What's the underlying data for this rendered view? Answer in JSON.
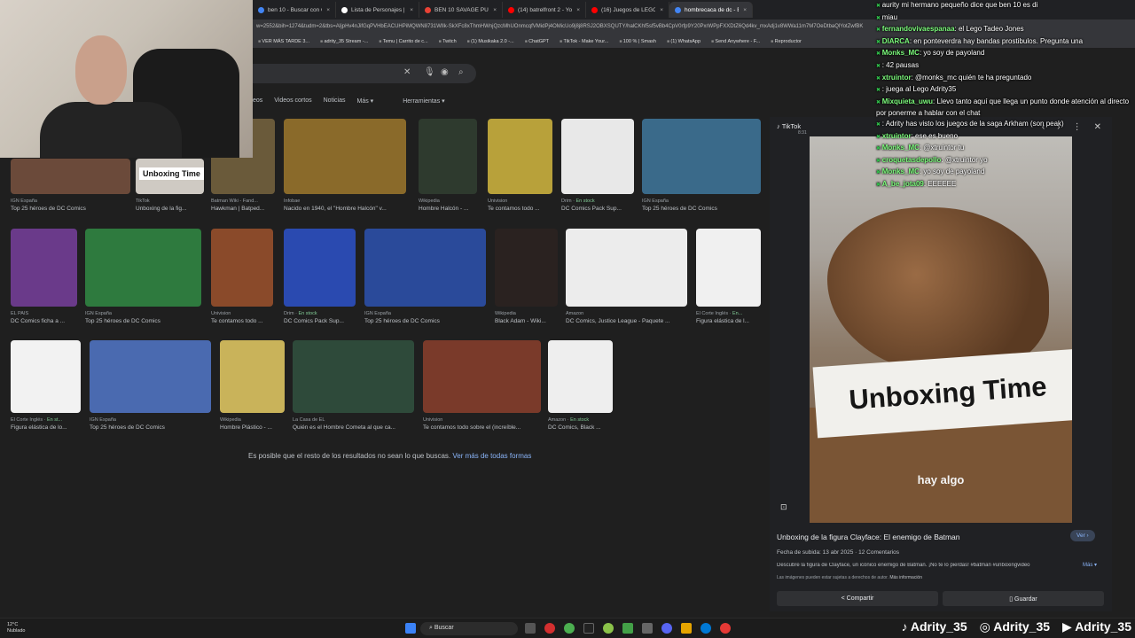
{
  "tabs": [
    {
      "label": "ben 10 - Buscar con Google",
      "color": "#4285f4",
      "active": false
    },
    {
      "label": "Lista de Personajes | Ben 10 Wiki",
      "color": "#ffffff",
      "active": false
    },
    {
      "label": "BEN 10 SAVAGE PURSUIT juego g",
      "color": "#e94235",
      "active": false
    },
    {
      "label": "(14) batrelfront 2 - YouTube",
      "color": "#ff0000",
      "active": false
    },
    {
      "label": "(16) Juegos de LEGO - Del Peor al",
      "color": "#ff0000",
      "active": false
    },
    {
      "label": "hombrecaca de dc - Buscar con G",
      "color": "#4285f4",
      "active": true
    }
  ],
  "address_text": "w=2552&bih=1274&tudm=2&tbs=AIjpHv4nJifGqPVHbEACUHPiMQWN8731WIlk-SkXFc8xThmHWnjQzcMhUOnmcqfVMidPj4OMicUo9j8j8RSJ2OBXSQUTY/halCKhf5sf5vBb4CpV0rfp9Y20PxrWPpFXXDtZ6Qd4kv_mxAdj1v8WWa11m7M7OeDtbaQlYotZwfBK",
  "bookmarks": [
    "VER MÁS TARDE 3...",
    "adrity_35 Stream -...",
    "Temu | Carrito de c...",
    "Twitch",
    "(1) Musikaka 2.0 -...",
    "ChatGPT",
    "TikTok - Make Your...",
    "100 % | Smash",
    "(1) WhatsApp",
    "Send Anywhere - F...",
    "Reproductor"
  ],
  "filters": {
    "tab1": "eos",
    "tab2": "Videos cortos",
    "tab3": "Noticias",
    "more": "Más ▾",
    "tools": "Herramientas ▾"
  },
  "results": [
    {
      "src": "IGN España",
      "ttl": "Top 25 héroes de DC Comics",
      "color": "#6b4a3a"
    },
    {
      "src": "TikTok",
      "ttl": "Unboxing de la fig...",
      "color": "#cfcac3",
      "label": "Unboxing Time"
    },
    {
      "src": "Batman Wiki - Fand...",
      "ttl": "Hawkman | Batped...",
      "color": "#6a5a3a"
    },
    {
      "src": "Infobae",
      "ttl": "Nacido en 1940, el \"Hombre Halcón\" v...",
      "color": "#8a6a2a"
    },
    {
      "src": "Wikipedia",
      "ttl": "Hombre Halcón - ...",
      "color": "#2e3a2e"
    },
    {
      "src": "Univision",
      "ttl": "Te contamos todo ...",
      "color": "#b8a13a"
    },
    {
      "src": "Drim",
      "stock": "En stock",
      "ttl": "DC Comics Pack Sup...",
      "color": "#e8e8e8"
    },
    {
      "src": "IGN España",
      "ttl": "Top 25 héroes de DC Comics",
      "color": "#3a6a8a"
    },
    {
      "src": "EL PAÍS",
      "ttl": "DC Comics ficha a ...",
      "color": "#6a3a8a"
    },
    {
      "src": "IGN España",
      "ttl": "Top 25 héroes de DC Comics",
      "color": "#2e7a3e"
    },
    {
      "src": "Univision",
      "ttl": "Te contamos todo ...",
      "color": "#8a4a2a"
    },
    {
      "src": "Drim",
      "stock": "En stock",
      "ttl": "DC Comics Pack Sup...",
      "color": "#2a4ab0"
    },
    {
      "src": "IGN España",
      "ttl": "Top 25 héroes de DC Comics",
      "color": "#2a4a9a"
    },
    {
      "src": "Wikipedia",
      "ttl": "Black Adam - Wiki...",
      "color": "#2a2220"
    },
    {
      "src": "Amazon",
      "ttl": "DC Comics, Justice League - Paquete ...",
      "color": "#ececec"
    },
    {
      "src": "El Corte Inglés",
      "stock": "En...",
      "ttl": "Figura elástica de l...",
      "color": "#f0f0f0"
    },
    {
      "src": "El Corte Inglés",
      "stock": "En st...",
      "ttl": "Figura elástica de lo...",
      "color": "#f2f2f2"
    },
    {
      "src": "IGN España",
      "ttl": "Top 25 héroes de DC Comics",
      "color": "#4a6ab0"
    },
    {
      "src": "Wikipedia",
      "ttl": "Hombre Plástico - ...",
      "color": "#c9b35a"
    },
    {
      "src": "La Casa de EL",
      "ttl": "Quién es el Hombre Cometa al que ca...",
      "color": "#2e4a3a"
    },
    {
      "src": "Univision",
      "ttl": "Te contamos todo sobre el (increíble...",
      "color": "#7a3a2a"
    },
    {
      "src": "Amazon",
      "stock": "En stock",
      "ttl": "DC Comics, Black ...",
      "color": "#eeeeee"
    }
  ],
  "footer": {
    "text": "Es posible que el resto de los resultados no sean lo que buscas.",
    "link": "Ver más de todas formas"
  },
  "panel": {
    "source": "TikTok",
    "time": "8:31",
    "banner": "Unboxing Time",
    "caption": "hay algo",
    "title": "Unboxing de la figura Clayface: El enemigo de Batman",
    "meta": "Fecha de subida: 13 abr 2025 · 12 Comentarios",
    "desc": "Descubre la figura de Clayface, un icónico enemigo de Batman. ¡No te lo pierdas! #batman #unboxingvideo",
    "note": "Las imágenes pueden estar sujetas a derechos de autor.",
    "note_link": "Más información",
    "ver": "Ver ›",
    "mas": "Más ▾",
    "share": "< Compartir",
    "save": "▯ Guardar"
  },
  "chat": [
    {
      "user": "",
      "text": "aurity mi hermano pequeño dice que ben 10 es di"
    },
    {
      "user": "",
      "text": "miau"
    },
    {
      "user": "fernandovivaespanaa",
      "text": ": el Lego Tadeo Jones"
    },
    {
      "user": "DIARCA",
      "text": ": en ponteverdra hay bandas prostibulos. Pregunta una"
    },
    {
      "user": "Monks_MC",
      "text": ": yo soy de payoland"
    },
    {
      "user": "",
      "text": ": 42 pausas"
    },
    {
      "user": "xtruintor",
      "text": ": @monks_mc quién te ha preguntado"
    },
    {
      "user": "",
      "text": ": juega al Lego Adrity35"
    },
    {
      "user": "Mixquieta_uwu",
      "text": ": Llevo tanto aquí que llega un punto donde atención al directo por ponerme a hablar con el chat"
    },
    {
      "user": "",
      "text": ": Adrity has visto los juegos de la saga Arkham (son peak)"
    },
    {
      "user": "xtruintor",
      "text": ": ese es bueno"
    },
    {
      "user": "Monks_MC",
      "text": ": @xtruintor tu"
    },
    {
      "user": "croquetasdepollo",
      "text": ": @xtruintor yo"
    },
    {
      "user": "Monks_MC",
      "text": ": yo soy de payoland"
    },
    {
      "user": "A_be_jota09",
      "text": ": EEEEEE"
    }
  ],
  "taskbar": {
    "temp": "12°C",
    "weather": "Nublado",
    "search": "Buscar"
  },
  "handles": [
    "Adrity_35",
    "Adrity_35",
    "Adrity_35"
  ]
}
